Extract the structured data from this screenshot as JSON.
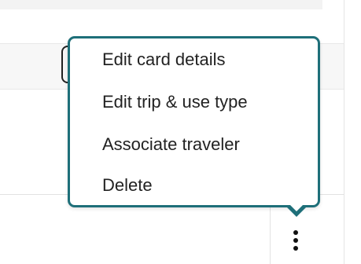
{
  "context_menu": {
    "items": [
      {
        "label": "Edit card details"
      },
      {
        "label": "Edit trip & use type"
      },
      {
        "label": "Associate traveler"
      },
      {
        "label": "Delete"
      }
    ],
    "border_color": "#1e6f79"
  },
  "row_actions": {
    "icon": "more-vertical-icon"
  }
}
